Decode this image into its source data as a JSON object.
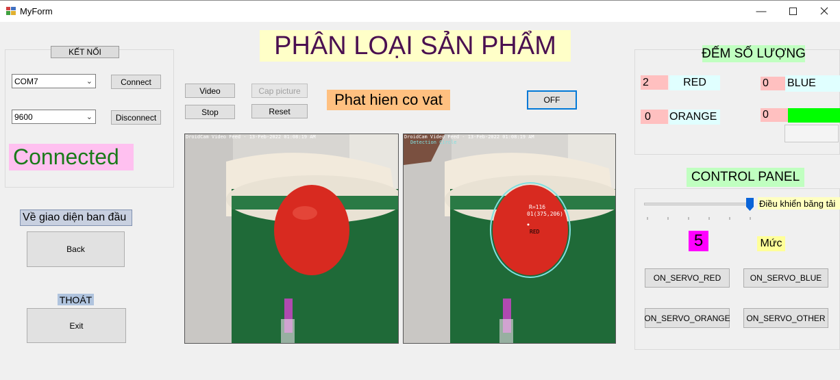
{
  "window": {
    "title": "MyForm"
  },
  "colors": {
    "pink": "#ffc0cb",
    "cyan": "#e0ffff",
    "green": "#00ff00",
    "yellow": "#ffffc0",
    "orange": "#ffc080",
    "magenta": "#ff00ff",
    "lightgreen": "#c0ffc0",
    "slate": "#b0c4de"
  },
  "connection": {
    "header": "KẾT NỐI",
    "port": "COM7",
    "baud": "9600",
    "connect_label": "Connect",
    "disconnect_label": "Disconnect",
    "status": "Connected"
  },
  "nav": {
    "home_label": "Về giao diện ban đầu",
    "back_label": "Back",
    "exit_header": "THOÁT",
    "exit_label": "Exit"
  },
  "main": {
    "title": "PHÂN LOẠI SẢN PHẨM",
    "video_label": "Video",
    "stop_label": "Stop",
    "cap_label": "Cap picture",
    "reset_label": "Reset",
    "detect_status": "Phat hien co vat",
    "toggle_label": "OFF"
  },
  "feeds": {
    "left_overlay": "DroidCam Video Feed - 13-Feb-2022 01:08:19 AM",
    "right_overlay": "DroidCam Video Feed - 13-Feb-2022 01:08:19 AM",
    "right_sub": "Detection Circle",
    "radius": "R=116",
    "center": "01(375,206)",
    "detected": "RED"
  },
  "counter": {
    "header": "ĐẾM SỐ LƯỢNG",
    "red_count": "2",
    "red_label": "RED",
    "blue_count": "0",
    "blue_label": "BLUE",
    "orange_count": "0",
    "orange_label": "ORANGE",
    "other_count": "0"
  },
  "control": {
    "header": "CONTROL PANEL",
    "slider_caption": "Điều khiển băng tải",
    "slider_value": 5,
    "slider_max": 5,
    "level_value": "5",
    "level_label": "Mức",
    "servo_red": "ON_SERVO_RED",
    "servo_blue": "ON_SERVO_BLUE",
    "servo_orange": "ON_SERVO_ORANGE",
    "servo_other": "ON_SERVO_OTHER"
  }
}
